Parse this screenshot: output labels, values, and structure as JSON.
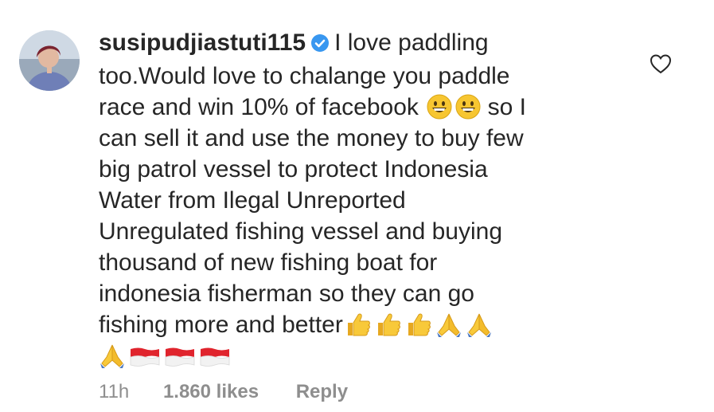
{
  "comment": {
    "username": "susipudjiastuti115",
    "verified": true,
    "lines": [
      "I love paddling",
      "too.Would love to chalange you paddle",
      "race and win 10% of facebook",
      "so I",
      "can sell it and use the money to buy few",
      "big patrol vessel to protect Indonesia",
      "Water from Ilegal Unreported",
      "Unregulated fishing vessel and buying",
      "thousand of new fishing boat for",
      "indonesia fisherman so they can go",
      "fishing more and better"
    ],
    "emojis": {
      "line3": [
        "grinning-face",
        "grinning-face"
      ],
      "line11": [
        "thumbs-up",
        "thumbs-up",
        "thumbs-up",
        "folded-hands",
        "folded-hands"
      ],
      "line12": [
        "folded-hands",
        "indonesia-flag",
        "indonesia-flag",
        "indonesia-flag"
      ]
    },
    "time": "11h",
    "likes": "1.860 likes",
    "reply_label": "Reply"
  },
  "icons": {
    "verified": "verified-badge-icon",
    "like": "heart-icon"
  },
  "colors": {
    "text": "#262626",
    "meta": "#8e8e8e",
    "verified": "#3897f0",
    "flag_red": "#e0242d"
  }
}
